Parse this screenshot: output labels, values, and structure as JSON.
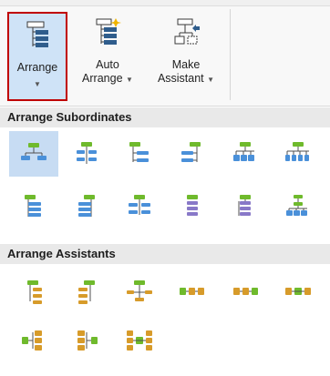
{
  "ribbon": {
    "arrange": {
      "line1": "Arrange",
      "icon": "arrange-icon"
    },
    "auto_arrange": {
      "line1": "Auto",
      "line2": "Arrange",
      "icon": "auto-arrange-icon"
    },
    "make_assistant": {
      "line1": "Make",
      "line2": "Assistant",
      "icon": "make-assistant-icon"
    }
  },
  "sections": {
    "subordinates": {
      "title": "Arrange Subordinates",
      "items": [
        {
          "icon": "subordinates-standard-icon",
          "selected": true
        },
        {
          "icon": "subordinates-both-icon",
          "selected": false
        },
        {
          "icon": "subordinates-right-hanging-icon",
          "selected": false
        },
        {
          "icon": "subordinates-left-hanging-icon",
          "selected": false
        },
        {
          "icon": "subordinates-horizontal-icon",
          "selected": false
        },
        {
          "icon": "subordinates-wide-horizontal-icon",
          "selected": false
        },
        {
          "icon": "subordinates-vertical-right-icon",
          "selected": false
        },
        {
          "icon": "subordinates-vertical-left-icon",
          "selected": false
        },
        {
          "icon": "subordinates-vertical-both-icon",
          "selected": false
        },
        {
          "icon": "subordinates-stack-icon",
          "selected": false
        },
        {
          "icon": "subordinates-stack-lines-icon",
          "selected": false
        },
        {
          "icon": "subordinates-grouped-icon",
          "selected": false
        }
      ]
    },
    "assistants": {
      "title": "Arrange Assistants",
      "items": [
        {
          "icon": "assistant-right-icon"
        },
        {
          "icon": "assistant-left-icon"
        },
        {
          "icon": "assistant-both-icon"
        },
        {
          "icon": "assistant-horizontal-left-icon"
        },
        {
          "icon": "assistant-horizontal-right-icon"
        },
        {
          "icon": "assistant-horizontal-both-icon"
        },
        {
          "icon": "assistant-stacked-left-icon"
        },
        {
          "icon": "assistant-stacked-right-icon"
        },
        {
          "icon": "assistant-stacked-both-icon"
        }
      ]
    }
  },
  "colors": {
    "green": "#6fba2c",
    "blue": "#4a90d9",
    "orange": "#d79b2a",
    "purple": "#8878c8",
    "line": "#505050"
  }
}
